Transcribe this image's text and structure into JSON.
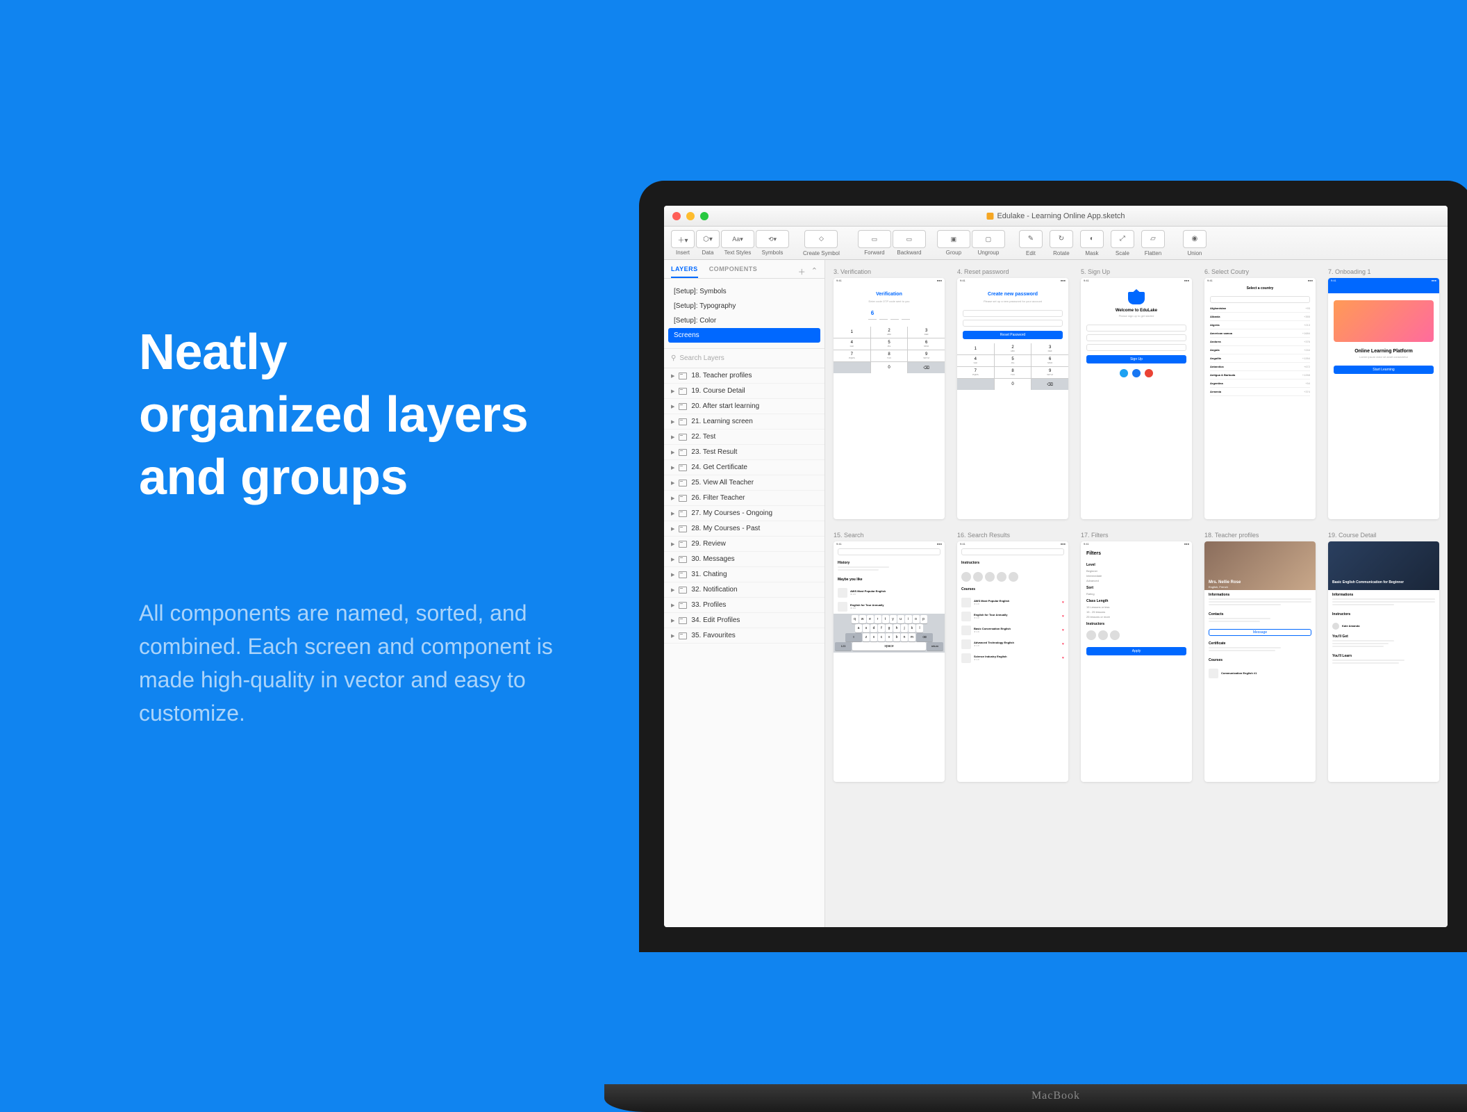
{
  "headline_l1": "Neatly",
  "headline_l2": "organized layers",
  "headline_l3": "and groups",
  "subtext": "All components are named, sorted, and combined. Each screen and component is made high-quality in vector and easy to customize.",
  "window_title": "Edulake - Learning Online App.sketch",
  "toolbar": {
    "insert": "Insert",
    "data": "Data",
    "textstyles": "Text Styles",
    "symbols": "Symbols",
    "create_symbol": "Create Symbol",
    "forward": "Forward",
    "backward": "Backward",
    "group": "Group",
    "ungroup": "Ungroup",
    "edit": "Edit",
    "rotate": "Rotate",
    "mask": "Mask",
    "scale": "Scale",
    "flatten": "Flatten",
    "union": "Union"
  },
  "sidebar": {
    "tab_layers": "LAYERS",
    "tab_components": "COMPONENTS",
    "pages": [
      "[Setup]: Symbols",
      "[Setup]: Typography",
      "[Setup]: Color",
      "Screens"
    ],
    "search_placeholder": "Search Layers",
    "layers": [
      "18. Teacher profiles",
      "19. Course Detail",
      "20. After start learning",
      "21. Learning screen",
      "22. Test",
      "23. Test Result",
      "24. Get Certificate",
      "25. View All Teacher",
      "26. Filter Teacher",
      "27. My Courses - Ongoing",
      "28. My Courses - Past",
      "29. Review",
      "30. Messages",
      "31. Chating",
      "32. Notification",
      "33. Profiles",
      "34. Edit Profiles",
      "35. Favourites"
    ]
  },
  "artboards_row1": [
    {
      "title": "3. Verification",
      "heading": "Verification",
      "otp": "6"
    },
    {
      "title": "4. Reset password",
      "heading": "Create new password",
      "btn": "Reset Password"
    },
    {
      "title": "5. Sign Up",
      "welcome": "Welcome to EduLake",
      "btn": "Sign Up"
    },
    {
      "title": "6. Select Coutry",
      "heading": "Select a country",
      "countries": [
        {
          "n": "Afghanistan",
          "c": "+93"
        },
        {
          "n": "Albania",
          "c": "+355"
        },
        {
          "n": "Algeria",
          "c": "+213"
        },
        {
          "n": "American samoa",
          "c": "+1684"
        },
        {
          "n": "Andorra",
          "c": "+376"
        },
        {
          "n": "Angola",
          "c": "+244"
        },
        {
          "n": "Anguilla",
          "c": "+1264"
        },
        {
          "n": "Antarctica",
          "c": "+672"
        },
        {
          "n": "Antigua & Barbuda",
          "c": "+1268"
        },
        {
          "n": "Argentina",
          "c": "+54"
        },
        {
          "n": "Armenia",
          "c": "+374"
        }
      ]
    },
    {
      "title": "7. Onboading 1",
      "heading": "Online Learning Platform",
      "btn": "Start Learning"
    }
  ],
  "artboards_row2": [
    {
      "title": "15. Search"
    },
    {
      "title": "16. Search Results"
    },
    {
      "title": "17. Filters",
      "heading": "Filters",
      "btn": "Apply",
      "groups": [
        {
          "lbl": "Level",
          "opts": [
            "Beginner",
            "Intermediate",
            "Advanced"
          ]
        },
        {
          "lbl": "Sort",
          "opts": [
            "Rating"
          ]
        },
        {
          "lbl": "Class Length",
          "opts": [
            "15 Lessons or less",
            "15 - 25 lessons",
            "25 lessons or more"
          ]
        },
        {
          "lbl": "Instructors"
        }
      ]
    },
    {
      "title": "18. Teacher profiles",
      "name": "Mrs. Nellie Rose",
      "sub": "English, French"
    },
    {
      "title": "19. Course Detail",
      "name": "Basic English Communication for Beginner"
    }
  ],
  "keypad": [
    {
      "n": "1",
      "l": ""
    },
    {
      "n": "2",
      "l": "ABC"
    },
    {
      "n": "3",
      "l": "DEF"
    },
    {
      "n": "4",
      "l": "GHI"
    },
    {
      "n": "5",
      "l": "JKL"
    },
    {
      "n": "6",
      "l": "MNO"
    },
    {
      "n": "7",
      "l": "PQRS"
    },
    {
      "n": "8",
      "l": "TUV"
    },
    {
      "n": "9",
      "l": "WXYZ"
    },
    {
      "n": "",
      "l": ""
    },
    {
      "n": "0",
      "l": ""
    },
    {
      "n": "⌫",
      "l": ""
    }
  ],
  "courses": [
    {
      "n": "AWS Most Popular English"
    },
    {
      "n": "English for Tour Annually"
    },
    {
      "n": "Basic Conversation English"
    },
    {
      "n": "Advanced Technology English"
    },
    {
      "n": "Science Industry English"
    }
  ],
  "laptop_brand": "MacBook"
}
